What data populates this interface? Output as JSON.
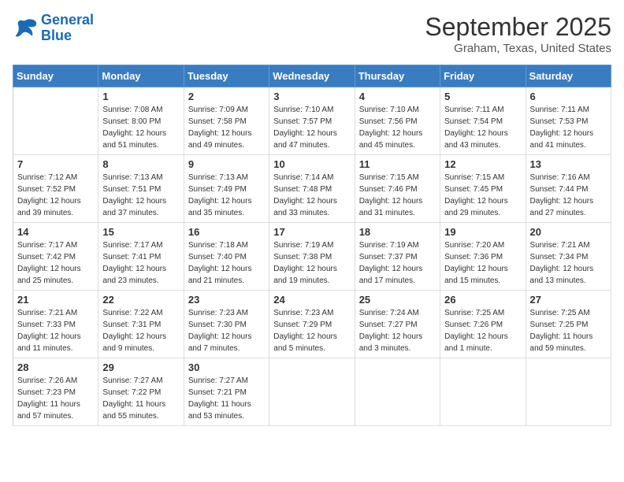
{
  "logo": {
    "line1": "General",
    "line2": "Blue"
  },
  "title": "September 2025",
  "subtitle": "Graham, Texas, United States",
  "days_of_week": [
    "Sunday",
    "Monday",
    "Tuesday",
    "Wednesday",
    "Thursday",
    "Friday",
    "Saturday"
  ],
  "weeks": [
    [
      {
        "num": "",
        "sunrise": "",
        "sunset": "",
        "daylight": ""
      },
      {
        "num": "1",
        "sunrise": "Sunrise: 7:08 AM",
        "sunset": "Sunset: 8:00 PM",
        "daylight": "Daylight: 12 hours and 51 minutes."
      },
      {
        "num": "2",
        "sunrise": "Sunrise: 7:09 AM",
        "sunset": "Sunset: 7:58 PM",
        "daylight": "Daylight: 12 hours and 49 minutes."
      },
      {
        "num": "3",
        "sunrise": "Sunrise: 7:10 AM",
        "sunset": "Sunset: 7:57 PM",
        "daylight": "Daylight: 12 hours and 47 minutes."
      },
      {
        "num": "4",
        "sunrise": "Sunrise: 7:10 AM",
        "sunset": "Sunset: 7:56 PM",
        "daylight": "Daylight: 12 hours and 45 minutes."
      },
      {
        "num": "5",
        "sunrise": "Sunrise: 7:11 AM",
        "sunset": "Sunset: 7:54 PM",
        "daylight": "Daylight: 12 hours and 43 minutes."
      },
      {
        "num": "6",
        "sunrise": "Sunrise: 7:11 AM",
        "sunset": "Sunset: 7:53 PM",
        "daylight": "Daylight: 12 hours and 41 minutes."
      }
    ],
    [
      {
        "num": "7",
        "sunrise": "Sunrise: 7:12 AM",
        "sunset": "Sunset: 7:52 PM",
        "daylight": "Daylight: 12 hours and 39 minutes."
      },
      {
        "num": "8",
        "sunrise": "Sunrise: 7:13 AM",
        "sunset": "Sunset: 7:51 PM",
        "daylight": "Daylight: 12 hours and 37 minutes."
      },
      {
        "num": "9",
        "sunrise": "Sunrise: 7:13 AM",
        "sunset": "Sunset: 7:49 PM",
        "daylight": "Daylight: 12 hours and 35 minutes."
      },
      {
        "num": "10",
        "sunrise": "Sunrise: 7:14 AM",
        "sunset": "Sunset: 7:48 PM",
        "daylight": "Daylight: 12 hours and 33 minutes."
      },
      {
        "num": "11",
        "sunrise": "Sunrise: 7:15 AM",
        "sunset": "Sunset: 7:46 PM",
        "daylight": "Daylight: 12 hours and 31 minutes."
      },
      {
        "num": "12",
        "sunrise": "Sunrise: 7:15 AM",
        "sunset": "Sunset: 7:45 PM",
        "daylight": "Daylight: 12 hours and 29 minutes."
      },
      {
        "num": "13",
        "sunrise": "Sunrise: 7:16 AM",
        "sunset": "Sunset: 7:44 PM",
        "daylight": "Daylight: 12 hours and 27 minutes."
      }
    ],
    [
      {
        "num": "14",
        "sunrise": "Sunrise: 7:17 AM",
        "sunset": "Sunset: 7:42 PM",
        "daylight": "Daylight: 12 hours and 25 minutes."
      },
      {
        "num": "15",
        "sunrise": "Sunrise: 7:17 AM",
        "sunset": "Sunset: 7:41 PM",
        "daylight": "Daylight: 12 hours and 23 minutes."
      },
      {
        "num": "16",
        "sunrise": "Sunrise: 7:18 AM",
        "sunset": "Sunset: 7:40 PM",
        "daylight": "Daylight: 12 hours and 21 minutes."
      },
      {
        "num": "17",
        "sunrise": "Sunrise: 7:19 AM",
        "sunset": "Sunset: 7:38 PM",
        "daylight": "Daylight: 12 hours and 19 minutes."
      },
      {
        "num": "18",
        "sunrise": "Sunrise: 7:19 AM",
        "sunset": "Sunset: 7:37 PM",
        "daylight": "Daylight: 12 hours and 17 minutes."
      },
      {
        "num": "19",
        "sunrise": "Sunrise: 7:20 AM",
        "sunset": "Sunset: 7:36 PM",
        "daylight": "Daylight: 12 hours and 15 minutes."
      },
      {
        "num": "20",
        "sunrise": "Sunrise: 7:21 AM",
        "sunset": "Sunset: 7:34 PM",
        "daylight": "Daylight: 12 hours and 13 minutes."
      }
    ],
    [
      {
        "num": "21",
        "sunrise": "Sunrise: 7:21 AM",
        "sunset": "Sunset: 7:33 PM",
        "daylight": "Daylight: 12 hours and 11 minutes."
      },
      {
        "num": "22",
        "sunrise": "Sunrise: 7:22 AM",
        "sunset": "Sunset: 7:31 PM",
        "daylight": "Daylight: 12 hours and 9 minutes."
      },
      {
        "num": "23",
        "sunrise": "Sunrise: 7:23 AM",
        "sunset": "Sunset: 7:30 PM",
        "daylight": "Daylight: 12 hours and 7 minutes."
      },
      {
        "num": "24",
        "sunrise": "Sunrise: 7:23 AM",
        "sunset": "Sunset: 7:29 PM",
        "daylight": "Daylight: 12 hours and 5 minutes."
      },
      {
        "num": "25",
        "sunrise": "Sunrise: 7:24 AM",
        "sunset": "Sunset: 7:27 PM",
        "daylight": "Daylight: 12 hours and 3 minutes."
      },
      {
        "num": "26",
        "sunrise": "Sunrise: 7:25 AM",
        "sunset": "Sunset: 7:26 PM",
        "daylight": "Daylight: 12 hours and 1 minute."
      },
      {
        "num": "27",
        "sunrise": "Sunrise: 7:25 AM",
        "sunset": "Sunset: 7:25 PM",
        "daylight": "Daylight: 11 hours and 59 minutes."
      }
    ],
    [
      {
        "num": "28",
        "sunrise": "Sunrise: 7:26 AM",
        "sunset": "Sunset: 7:23 PM",
        "daylight": "Daylight: 11 hours and 57 minutes."
      },
      {
        "num": "29",
        "sunrise": "Sunrise: 7:27 AM",
        "sunset": "Sunset: 7:22 PM",
        "daylight": "Daylight: 11 hours and 55 minutes."
      },
      {
        "num": "30",
        "sunrise": "Sunrise: 7:27 AM",
        "sunset": "Sunset: 7:21 PM",
        "daylight": "Daylight: 11 hours and 53 minutes."
      },
      {
        "num": "",
        "sunrise": "",
        "sunset": "",
        "daylight": ""
      },
      {
        "num": "",
        "sunrise": "",
        "sunset": "",
        "daylight": ""
      },
      {
        "num": "",
        "sunrise": "",
        "sunset": "",
        "daylight": ""
      },
      {
        "num": "",
        "sunrise": "",
        "sunset": "",
        "daylight": ""
      }
    ]
  ]
}
